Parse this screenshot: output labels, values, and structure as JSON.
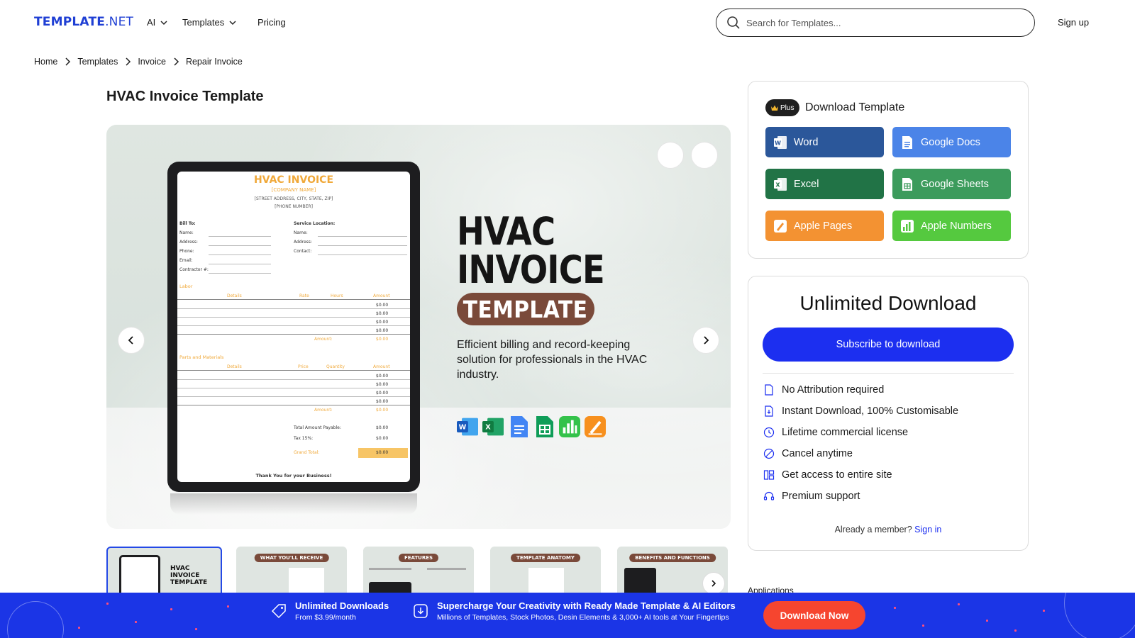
{
  "header": {
    "logo_main": "TEMPLATE",
    "logo_suffix": ".NET",
    "nav": [
      {
        "label": "AI"
      },
      {
        "label": "Templates"
      },
      {
        "label": "Pricing"
      }
    ],
    "search_placeholder": "Search for Templates...",
    "signup_label": "Sign up"
  },
  "breadcrumb": [
    "Home",
    "Templates",
    "Invoice",
    "Repair Invoice"
  ],
  "page_title": "HVAC Invoice Template",
  "preview": {
    "hero_line1": "HVAC",
    "hero_line2": "INVOICE",
    "hero_pill": "TEMPLATE",
    "hero_desc": "Efficient billing and record-keeping solution for professionals in the HVAC industry.",
    "invoice": {
      "title": "HVAC INVOICE",
      "company": "[COMPANY NAME]",
      "address": "[STREET ADDRESS, CITY, STATE, ZIP]",
      "phone": "[PHONE NUMBER]",
      "bill_to": "Bill To:",
      "service_location": "Service Location:",
      "bill_fields": [
        "Name:",
        "Address:",
        "Phone:",
        "Email:",
        "Contractor #:"
      ],
      "service_fields": [
        "Name:",
        "Address:",
        "Contact:"
      ],
      "labor": "Labor",
      "labor_headers": [
        "Details",
        "Rate",
        "Hours",
        "Amount"
      ],
      "parts": "Parts and Materials",
      "parts_headers": [
        "Details",
        "Price",
        "Quantity",
        "Amount"
      ],
      "zero": "$0.00",
      "amount_label": "Amount:",
      "total_payable": "Total Amount Payable:",
      "tax": "Tax 15%:",
      "grand_total": "Grand Total:",
      "thanks": "Thank You for your Business!"
    }
  },
  "thumbnails": [
    {
      "label": "HVAC INVOICE TEMPLATE"
    },
    {
      "label": "WHAT YOU'LL RECEIVE"
    },
    {
      "label": "FEATURES"
    },
    {
      "label": "TEMPLATE ANATOMY"
    },
    {
      "label": "BENEFITS AND FUNCTIONS"
    }
  ],
  "download_card": {
    "badge": "Plus",
    "title": "Download Template",
    "formats": [
      {
        "label": "Word",
        "color": "#2b579a"
      },
      {
        "label": "Google Docs",
        "color": "#4b84e8"
      },
      {
        "label": "Excel",
        "color": "#217346"
      },
      {
        "label": "Google Sheets",
        "color": "#3c9b5c"
      },
      {
        "label": "Apple Pages",
        "color": "#f39232"
      },
      {
        "label": "Apple Numbers",
        "color": "#55c93f"
      }
    ]
  },
  "unlimited_card": {
    "title": "Unlimited Download",
    "subscribe_label": "Subscribe to download",
    "features": [
      {
        "label": "No Attribution required",
        "icon": "file-icon"
      },
      {
        "label": "Instant Download, 100% Customisable",
        "icon": "file-download-icon"
      },
      {
        "label": "Lifetime commercial license",
        "icon": "clock-icon"
      },
      {
        "label": "Cancel anytime",
        "icon": "cancel-icon"
      },
      {
        "label": "Get access to entire site",
        "icon": "layout-icon"
      },
      {
        "label": "Premium support",
        "icon": "headset-icon"
      }
    ],
    "member_text": "Already a member?",
    "signin_label": "Sign in"
  },
  "applications_label": "Applications",
  "promo": {
    "item1_title": "Unlimited Downloads",
    "item1_sub": "From $3.99/month",
    "item2_title": "Supercharge Your Creativity with Ready Made Template & AI Editors",
    "item2_sub": "Millions of Templates, Stock Photos, Desin Elements & 3,000+ AI tools at Your Fingertips",
    "button_label": "Download Now"
  }
}
